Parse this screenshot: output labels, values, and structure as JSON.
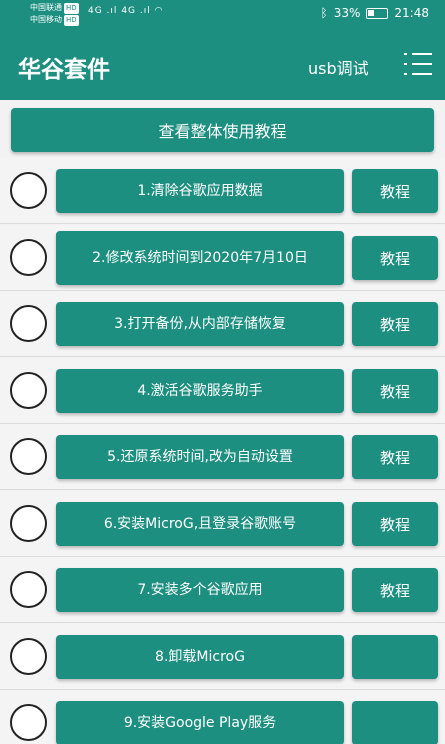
{
  "status_bar": {
    "carrier1": "中国联通",
    "carrier2": "中国移动",
    "hd": "HD",
    "signal1": "4G .ıl",
    "signal2": "4G .ıl",
    "battery": "33%",
    "time": "21:48"
  },
  "app": {
    "title": "华谷套件",
    "usb_debug": "usb调试"
  },
  "overall_tutorial": "查看整体使用教程",
  "tutorial_label": "教程",
  "steps": [
    {
      "label": "1.清除谷歌应用数据",
      "tutorial": "教程"
    },
    {
      "label": "2.修改系统时间到2020年7月10日",
      "tutorial": "教程"
    },
    {
      "label": "3.打开备份,从内部存储恢复",
      "tutorial": "教程"
    },
    {
      "label": "4.激活谷歌服务助手",
      "tutorial": "教程"
    },
    {
      "label": "5.还原系统时间,改为自动设置",
      "tutorial": "教程"
    },
    {
      "label": "6.安装MicroG,且登录谷歌账号",
      "tutorial": "教程"
    },
    {
      "label": "7.安装多个谷歌应用",
      "tutorial": "教程"
    },
    {
      "label": "8.卸载MicroG",
      "tutorial": ""
    },
    {
      "label": "9.安装Google Play服务",
      "tutorial": ""
    }
  ]
}
